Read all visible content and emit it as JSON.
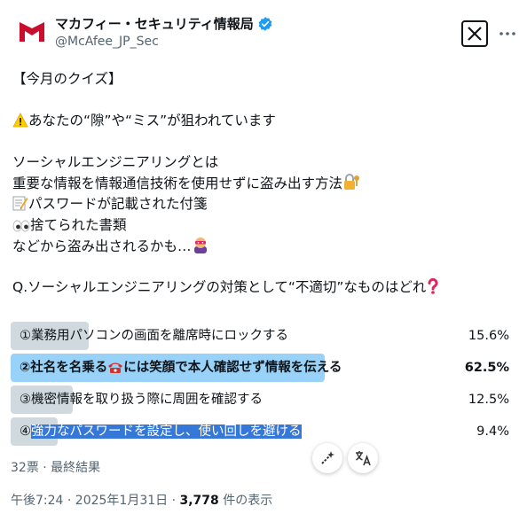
{
  "account": {
    "display_name": "マカフィー・セキュリティ情報局",
    "handle": "@McAfee_JP_Sec",
    "brand_color": "#c8102e",
    "verified_color": "#1d9bf0"
  },
  "tweet": {
    "line1": "【今月のクイズ】",
    "line2": "あなたの“隙”や“ミス”が狙われています",
    "line3": "ソーシャルエンジニアリングとは",
    "line4": "重要な情報を情報通信技術を使用せずに盗み出す方法",
    "line5": "パスワードが記載された付箋",
    "line6": "捨てられた書類",
    "line7": "などから盗み出されるかも…",
    "question": "Q.ソーシャルエンジニアリングの対策として“不適切”なものはどれ"
  },
  "poll": {
    "options": [
      {
        "label": "①業務用パソコンの画面を離席時にロックする",
        "percent_text": "15.6%",
        "percent": 15.6
      },
      {
        "label_a": "②社名を名乗る",
        "label_b": "には笑顔で本人確認せず情報を伝える",
        "percent_text": "62.5%",
        "percent": 62.5
      },
      {
        "label": "③機密情報を取り扱う際に周囲を確認する",
        "percent_text": "12.5%",
        "percent": 12.5
      },
      {
        "label_a": "④",
        "label_b": "強力なパスワードを設定し、使い回しを避ける",
        "percent_text": "9.4%",
        "percent": 9.4
      }
    ],
    "summary": "32票 · 最終結果"
  },
  "footer": {
    "time": "午後7:24 · 2025年1月31日 · ",
    "views": "3,778",
    "views_suffix": " 件の表示"
  },
  "icons": {
    "warning": "warning-icon",
    "lock_key": "lock-key-icon",
    "memo": "memo-icon",
    "eyes": "eyes-icon",
    "thief": "masked-thief-icon",
    "question_mark": "red-question-icon",
    "phone": "telephone-icon",
    "more": "more-icon",
    "x_logo": "x-logo-icon"
  }
}
